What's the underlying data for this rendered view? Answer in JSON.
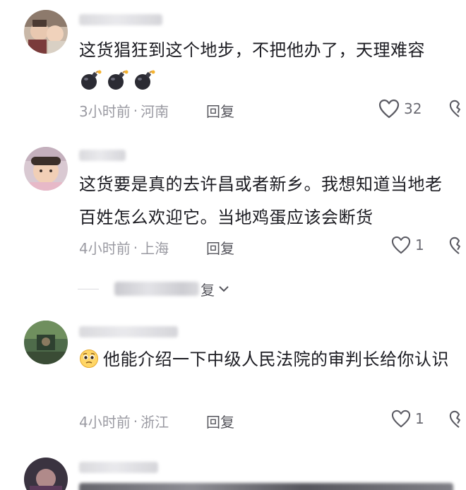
{
  "comments": [
    {
      "text": "这货猖狂到这个地步，不把他办了，天理难容",
      "emojis": [
        "bomb-emoji",
        "bomb-emoji",
        "bomb-emoji"
      ],
      "time": "3小时前",
      "location": "河南",
      "reply_label": "回复",
      "likes": "32"
    },
    {
      "text": "这货要是真的去许昌或者新乡。我想知道当地老百姓怎么欢迎它。当地鸡蛋应该会断货",
      "time": "4小时前",
      "location": "上海",
      "reply_label": "回复",
      "likes": "1"
    },
    {
      "emoji": "pleading-face-emoji",
      "text": "他能介绍一下中级人民法院的审判长给你认识",
      "time": "4小时前",
      "location": "浙江",
      "reply_label": "回复",
      "likes": "1"
    }
  ],
  "expand_replies": {
    "visible_text_fragment": "复"
  },
  "meta_separator": "·"
}
